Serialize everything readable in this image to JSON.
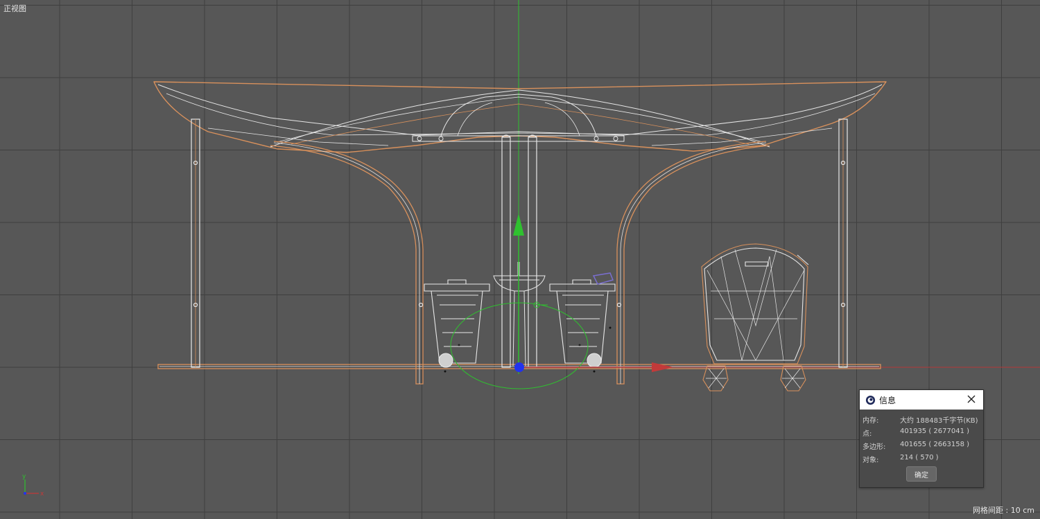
{
  "viewport": {
    "view_name": "正视图",
    "grid_spacing": "网格间距 : 10 cm"
  },
  "colors": {
    "background": "#575757",
    "grid_line": "#3f3f3f",
    "wire_white": "#e8e8e8",
    "wire_orange": "#d9915c",
    "axis_y": "#2fc12f",
    "axis_x": "#c23a3a",
    "axis_z": "#2233ee"
  },
  "axis_widget": {
    "y": "y",
    "x": "x"
  },
  "info_dialog": {
    "title": "信息",
    "logo_icon": "cinema4d-logo-icon",
    "close_icon": "close-icon",
    "rows": [
      {
        "label": "内存:",
        "value": "大约 188483千字节(KB)"
      },
      {
        "label": "点:",
        "value": "401935 ( 2677041 )"
      },
      {
        "label": "多边形:",
        "value": "401655 ( 2663158 )"
      },
      {
        "label": "对象:",
        "value": "214 ( 570 )"
      }
    ],
    "ok_label": "确定"
  }
}
